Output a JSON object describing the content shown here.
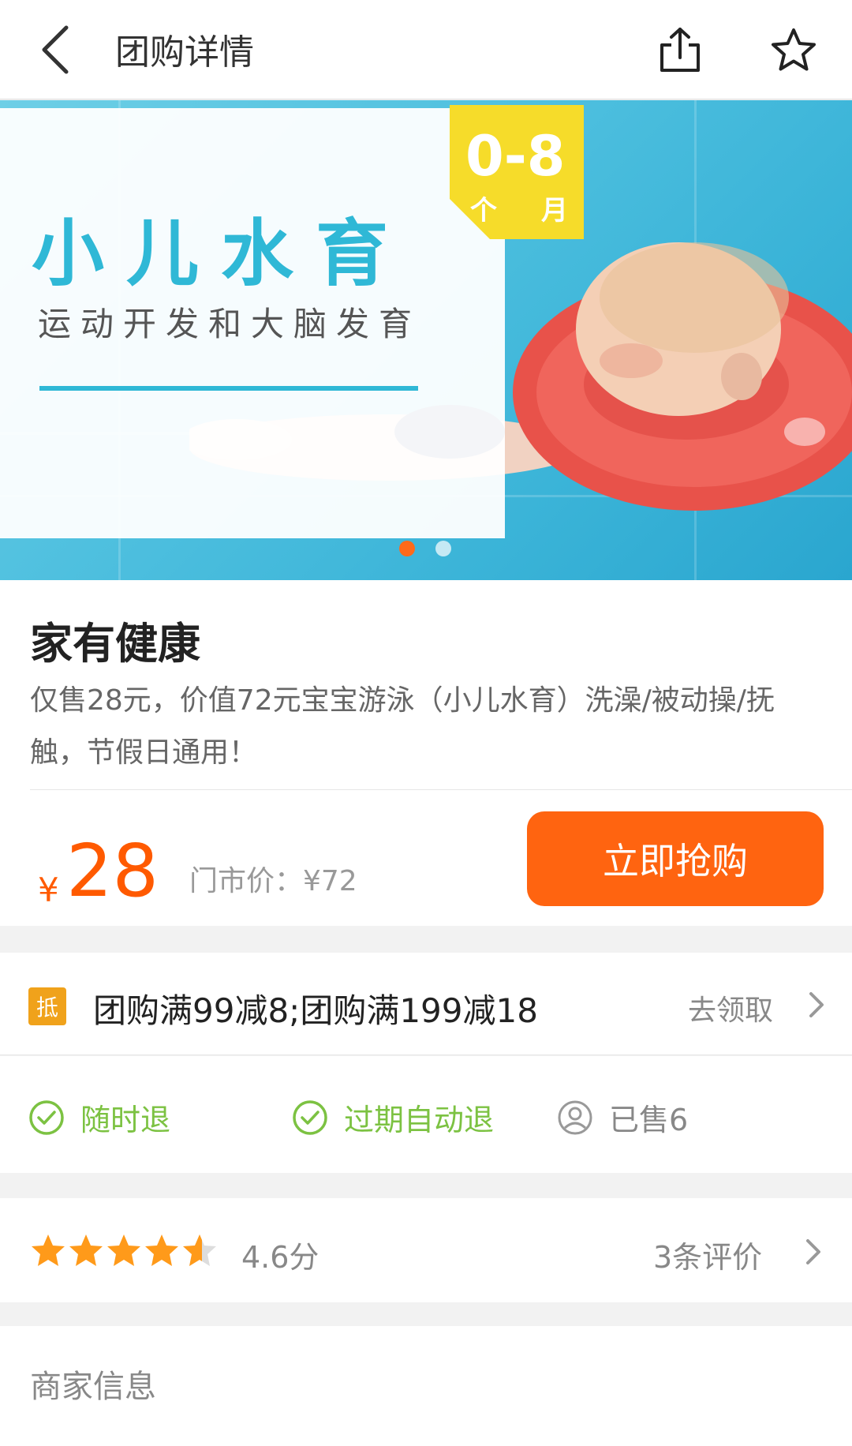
{
  "header": {
    "title": "团购详情"
  },
  "banner": {
    "title": "小儿水育",
    "subtitle": "运动开发和大脑发育",
    "age_range": "0-8",
    "age_unit_1": "个",
    "age_unit_2": "月",
    "page_count": 2,
    "active_page": 1
  },
  "product": {
    "merchant_name": "家有健康",
    "description": "仅售28元，价值72元宝宝游泳（小儿水育）洗澡/被动操/抚触，节假日通用！",
    "price_symbol": "¥",
    "price": "28",
    "market_price": "门市价：¥72",
    "buy_label": "立即抢购"
  },
  "coupon": {
    "badge": "抵",
    "text": "团购满99减8;团购满199减18",
    "action": "去领取"
  },
  "guarantees": {
    "refund_anytime": "随时退",
    "auto_refund": "过期自动退",
    "sold": "已售6"
  },
  "rating": {
    "stars": 4.6,
    "score": "4.6分",
    "reviews": "3条评价"
  },
  "merchant_info": {
    "title": "商家信息"
  },
  "colors": {
    "accent": "#ff6410",
    "price": "#ff5a00",
    "green": "#7cc242",
    "star": "#ff9a1a",
    "banner_blue": "#2fb8d6",
    "badge_yellow": "#f6dc2a"
  }
}
